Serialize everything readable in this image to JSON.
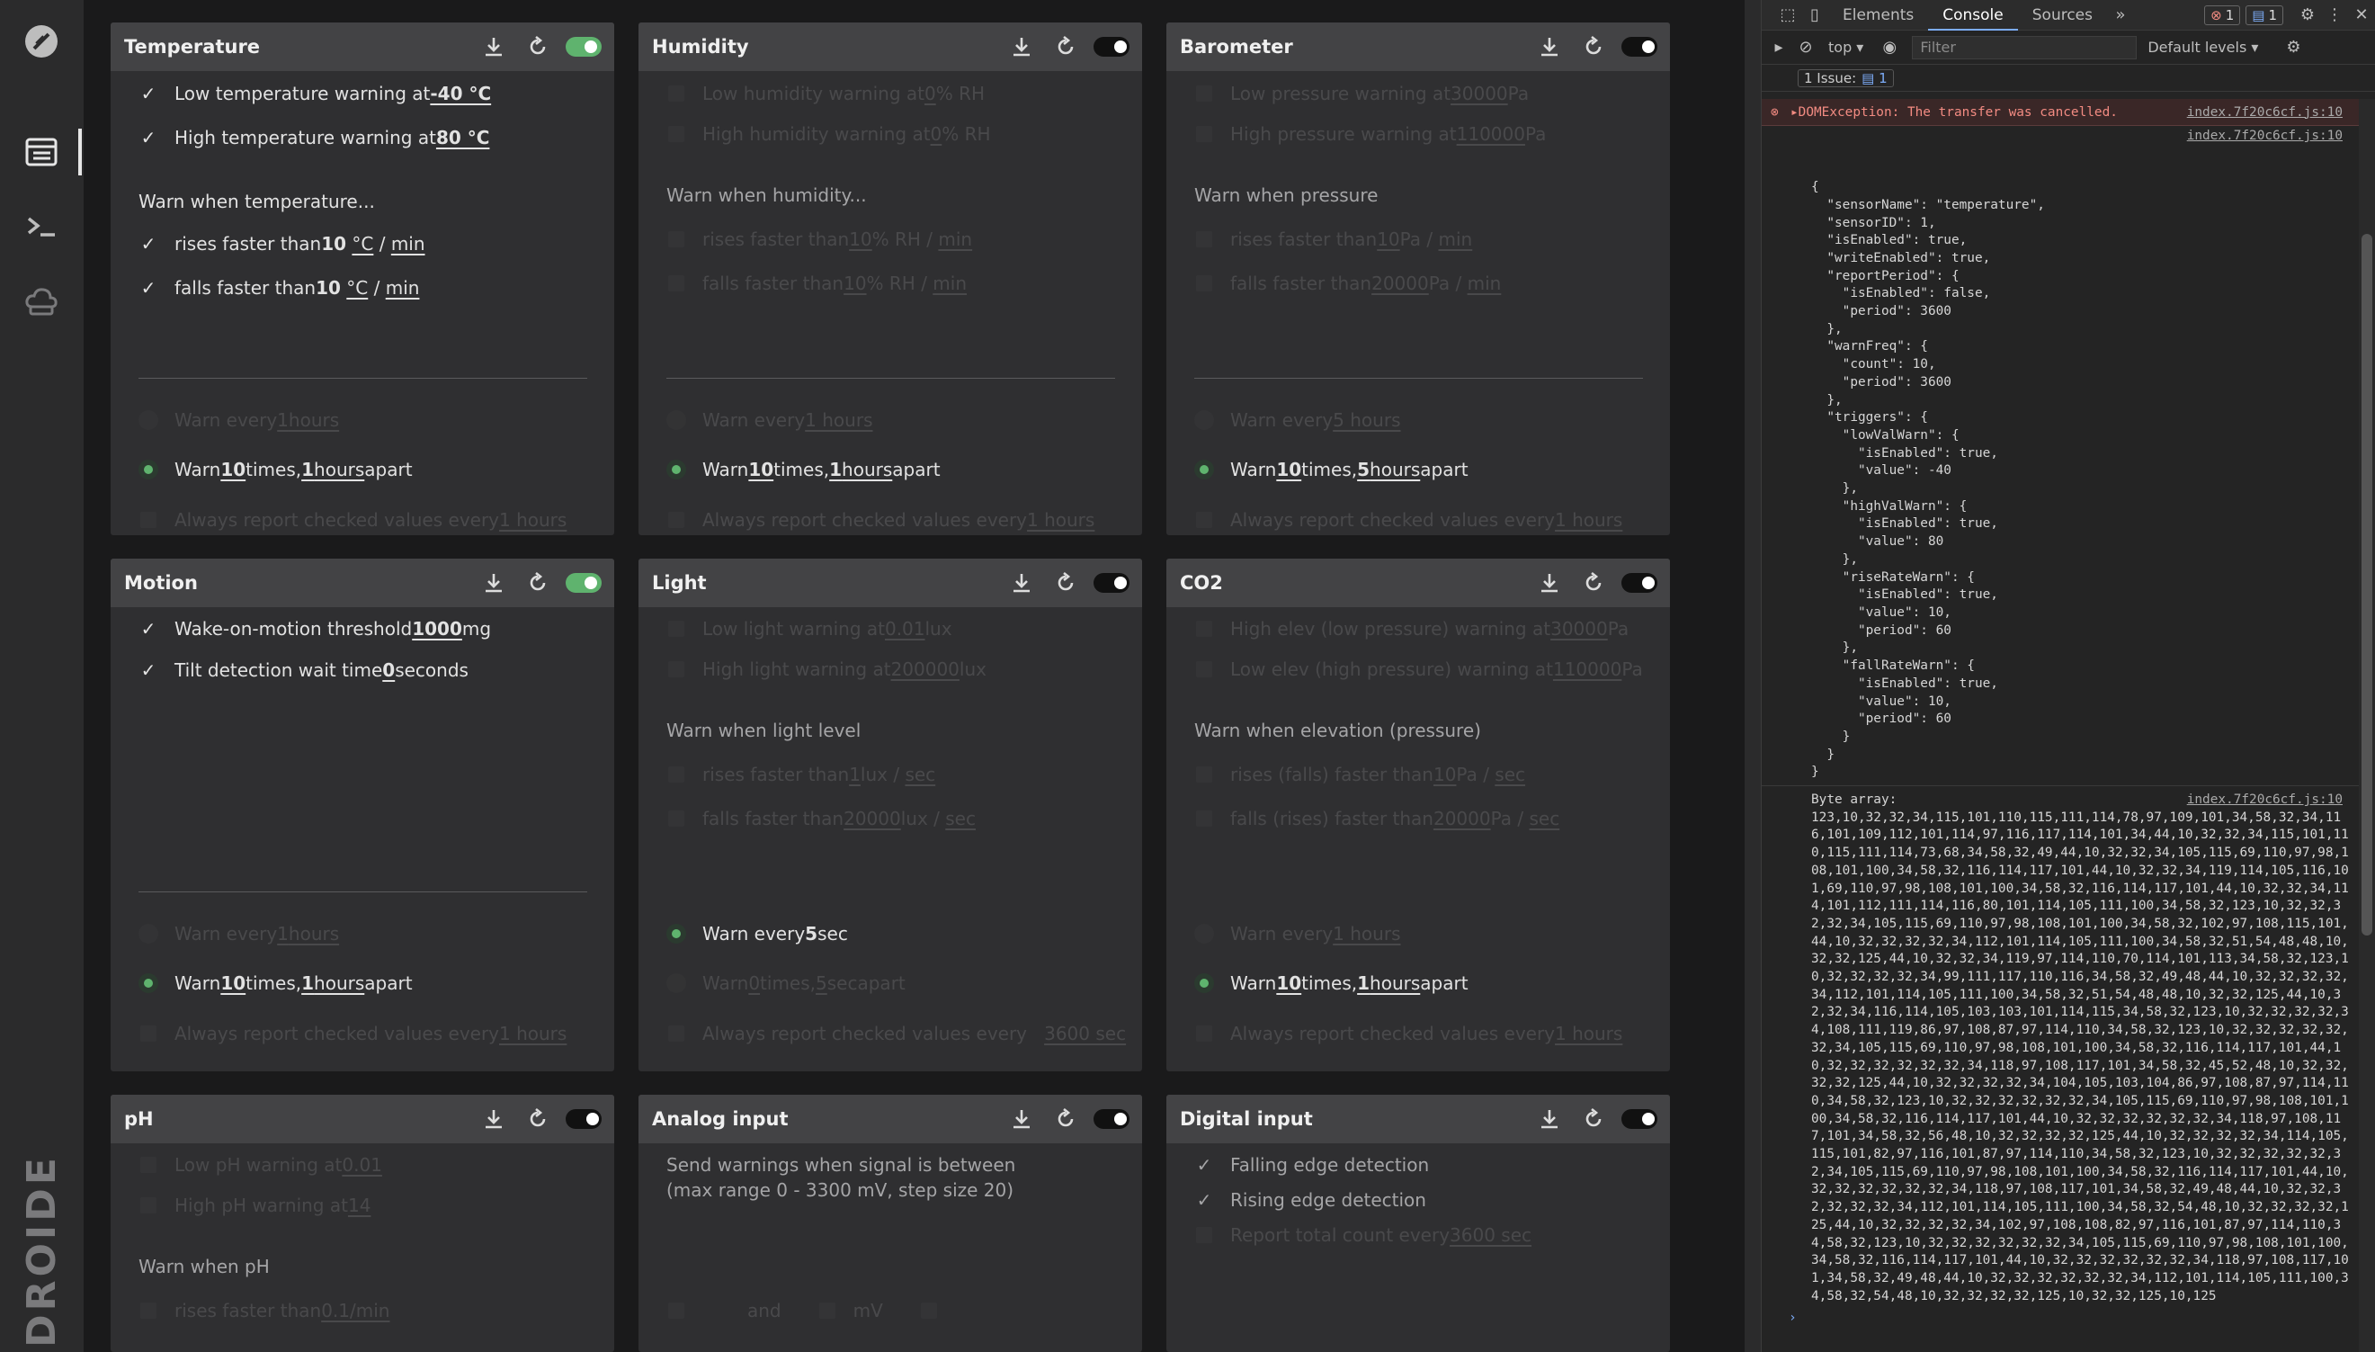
{
  "sidebar": {
    "items": [
      "logo-icon",
      "dashboard-icon",
      "terminal-icon",
      "cloud-icon"
    ],
    "brand": "DROIDE"
  },
  "cards": {
    "temperature": {
      "title": "Temperature",
      "low": [
        "Low temperature warning at ",
        "-40 °C"
      ],
      "high": [
        "High temperature warning at ",
        "80 °C"
      ],
      "warn_when": "Warn when temperature...",
      "rises": [
        "rises faster than ",
        "10",
        "°C",
        "min"
      ],
      "falls": [
        "falls faster than ",
        "10",
        "°C",
        "min"
      ],
      "every": [
        "Warn every ",
        "1",
        " hours"
      ],
      "times": [
        "Warn ",
        "10",
        " times, ",
        "1",
        " hours",
        " apart"
      ],
      "report": [
        "Always report checked values every ",
        "1 hours"
      ]
    },
    "humidity": {
      "title": "Humidity",
      "low": [
        "Low humidity warning at ",
        "0",
        " % RH"
      ],
      "high": [
        "High humidity warning at ",
        "0",
        " % RH"
      ],
      "warn_when": "Warn when humidity...",
      "rises": [
        "rises faster than ",
        "10",
        " % RH",
        "min"
      ],
      "falls": [
        "falls faster than ",
        "10",
        " % RH",
        "min"
      ],
      "every": [
        "Warn every ",
        "1 hours"
      ],
      "times": [
        "Warn ",
        "10",
        " times, ",
        "1",
        " hours",
        " apart"
      ],
      "report": [
        "Always report checked values every ",
        "1 hours"
      ]
    },
    "barometer": {
      "title": "Barometer",
      "low": [
        "Low pressure warning at ",
        "30000",
        " Pa"
      ],
      "high": [
        "High pressure warning at ",
        "110000",
        " Pa"
      ],
      "warn_when": "Warn when pressure",
      "rises": [
        "rises faster than ",
        "10",
        " Pa",
        "min"
      ],
      "falls": [
        "falls faster than ",
        "20000",
        " Pa",
        "min"
      ],
      "every": [
        "Warn every ",
        "5 hours"
      ],
      "times": [
        "Warn ",
        "10",
        " times, ",
        "5",
        " hours",
        " apart"
      ],
      "report": [
        "Always report checked values every ",
        "1 hours"
      ]
    },
    "motion": {
      "title": "Motion",
      "wake": [
        "Wake-on-motion threshold ",
        "1000",
        " mg"
      ],
      "tilt": [
        "Tilt detection wait time ",
        "0",
        " seconds"
      ],
      "every": [
        "Warn every ",
        "1",
        " hours"
      ],
      "times": [
        "Warn ",
        "10",
        " times, ",
        "1",
        " hours",
        " apart"
      ],
      "report": [
        "Always report checked values every ",
        "1 hours"
      ]
    },
    "light": {
      "title": "Light",
      "low": [
        "Low light warning at ",
        "0.01",
        " lux"
      ],
      "high": [
        "High light warning at ",
        "200000",
        " lux"
      ],
      "warn_when": "Warn when light level",
      "rises": [
        "rises faster than ",
        "1",
        " lux",
        "sec"
      ],
      "falls": [
        "falls faster than ",
        "20000",
        " lux",
        "sec"
      ],
      "every": [
        "Warn every ",
        "5",
        " sec"
      ],
      "times": [
        "Warn ",
        "0",
        " times, ",
        "5",
        " sec",
        " apart"
      ],
      "report": [
        "Always report checked values every",
        "3600 sec"
      ]
    },
    "co2": {
      "title": "CO2",
      "low": [
        "High elev (low pressure) warning at ",
        "30000",
        " Pa"
      ],
      "high": [
        "Low elev (high pressure) warning at ",
        "110000",
        " Pa"
      ],
      "warn_when": "Warn when elevation (pressure)",
      "rises": [
        "rises (falls) faster than ",
        "10",
        " Pa",
        "sec"
      ],
      "falls": [
        "falls (rises) faster than ",
        "20000",
        " Pa",
        "sec"
      ],
      "every": [
        "Warn every ",
        "1 hours"
      ],
      "times": [
        "Warn ",
        "10",
        " times, ",
        "1",
        " hours",
        " apart"
      ],
      "report": [
        "Always report checked values every ",
        "1 hours"
      ]
    },
    "ph": {
      "title": "pH",
      "low": [
        "Low pH warning at ",
        "0.01"
      ],
      "high": [
        "High pH warning at ",
        "14"
      ],
      "warn_when": "Warn when pH",
      "rises": [
        "rises faster than ",
        "0.1",
        " /min"
      ]
    },
    "analog": {
      "title": "Analog input",
      "desc1": "Send warnings when signal is between",
      "desc2": "(max range 0 - 3300 mV, step size 20)",
      "and": "and",
      "mv": "mV"
    },
    "digital": {
      "title": "Digital input",
      "falling": "Falling edge detection",
      "rising": "Rising edge detection",
      "report": [
        "Report total count every ",
        "3600 sec"
      ]
    }
  },
  "devtools": {
    "tabs": [
      "Elements",
      "Console",
      "Sources"
    ],
    "errors": "1",
    "messages": "1",
    "context": "top",
    "filter_placeholder": "Filter",
    "levels": "Default levels",
    "issues": "1 Issue:",
    "issues_count": "1",
    "error_text": "DOMException: The transfer was cancelled.",
    "source": "index.7f20c6cf.js:10",
    "json_lines": [
      "{",
      "  \"sensorName\": \"temperature\",",
      "  \"sensorID\": 1,",
      "  \"isEnabled\": true,",
      "  \"writeEnabled\": true,",
      "  \"reportPeriod\": {",
      "    \"isEnabled\": false,",
      "    \"period\": 3600",
      "  },",
      "  \"warnFreq\": {",
      "    \"count\": 10,",
      "    \"period\": 3600",
      "  },",
      "  \"triggers\": {",
      "    \"lowValWarn\": {",
      "      \"isEnabled\": true,",
      "      \"value\": -40",
      "    },",
      "    \"highValWarn\": {",
      "      \"isEnabled\": true,",
      "      \"value\": 80",
      "    },",
      "    \"riseRateWarn\": {",
      "      \"isEnabled\": true,",
      "      \"value\": 10,",
      "      \"period\": 60",
      "    },",
      "    \"fallRateWarn\": {",
      "      \"isEnabled\": true,",
      "      \"value\": 10,",
      "      \"period\": 60",
      "    }",
      "  }",
      "}"
    ],
    "byte_label": "Byte array:",
    "byte_text": "123,10,32,32,34,115,101,110,115,111,114,78,97,109,101,34,58,32,34,116,101,109,112,101,114,97,116,117,114,101,34,44,10,32,32,34,115,101,110,115,111,114,73,68,34,58,32,49,44,10,32,32,34,105,115,69,110,97,98,108,101,100,34,58,32,116,114,117,101,44,10,32,32,34,119,114,105,116,101,69,110,97,98,108,101,100,34,58,32,116,114,117,101,44,10,32,32,34,114,101,112,111,114,116,80,101,114,105,111,100,34,58,32,123,10,32,32,32,32,34,105,115,69,110,97,98,108,101,100,34,58,32,102,97,108,115,101,44,10,32,32,32,32,34,112,101,114,105,111,100,34,58,32,51,54,48,48,10,32,32,125,44,10,32,32,34,119,97,114,110,70,114,101,113,34,58,32,123,10,32,32,32,32,34,99,111,117,110,116,34,58,32,49,48,44,10,32,32,32,32,34,112,101,114,105,111,100,34,58,32,51,54,48,48,10,32,32,125,44,10,32,32,34,116,114,105,103,103,101,114,115,34,58,32,123,10,32,32,32,32,34,108,111,119,86,97,108,87,97,114,110,34,58,32,123,10,32,32,32,32,32,32,34,105,115,69,110,97,98,108,101,100,34,58,32,116,114,117,101,44,10,32,32,32,32,32,32,34,118,97,108,117,101,34,58,32,45,52,48,10,32,32,32,32,125,44,10,32,32,32,32,34,104,105,103,104,86,97,108,87,97,114,110,34,58,32,123,10,32,32,32,32,32,32,34,105,115,69,110,97,98,108,101,100,34,58,32,116,114,117,101,44,10,32,32,32,32,32,32,34,118,97,108,117,101,34,58,32,56,48,10,32,32,32,32,125,44,10,32,32,32,32,34,114,105,115,101,82,97,116,101,87,97,114,110,34,58,32,123,10,32,32,32,32,32,32,34,105,115,69,110,97,98,108,101,100,34,58,32,116,114,117,101,44,10,32,32,32,32,32,32,34,118,97,108,117,101,34,58,32,49,48,44,10,32,32,32,32,32,32,34,112,101,114,105,111,100,34,58,32,54,48,10,32,32,32,32,125,44,10,32,32,32,32,34,102,97,108,108,82,97,116,101,87,97,114,110,34,58,32,123,10,32,32,32,32,32,32,34,105,115,69,110,97,98,108,101,100,34,58,32,116,114,117,101,44,10,32,32,32,32,32,32,34,118,97,108,117,101,34,58,32,49,48,44,10,32,32,32,32,32,32,34,112,101,114,105,111,100,34,58,32,54,48,10,32,32,32,32,125,10,32,32,125,10,125"
  },
  "colors": {
    "accent_green": "#5fb36e",
    "error_red": "#f28b82"
  }
}
